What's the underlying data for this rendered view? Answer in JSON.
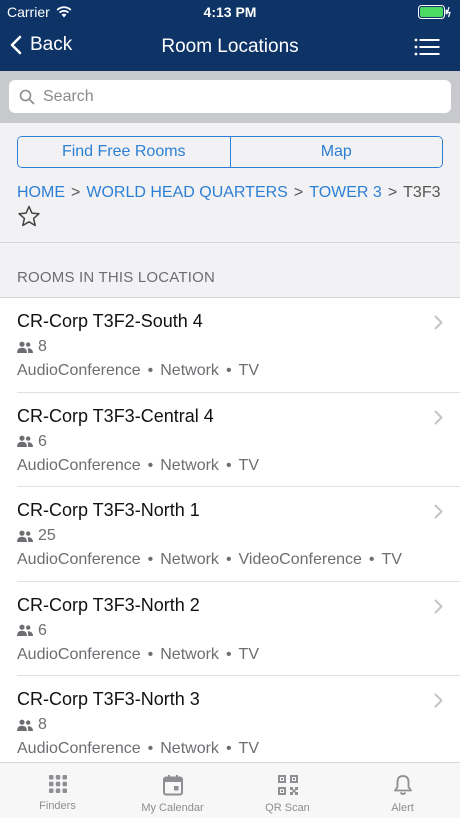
{
  "status": {
    "carrier": "Carrier",
    "time": "4:13 PM"
  },
  "nav": {
    "back_label": "Back",
    "title": "Room Locations"
  },
  "search": {
    "placeholder": "Search"
  },
  "segments": [
    "Find Free Rooms",
    "Map"
  ],
  "breadcrumb": {
    "items": [
      "HOME",
      "WORLD HEAD QUARTERS",
      "TOWER 3"
    ],
    "current": "T3F3",
    "separator": ">"
  },
  "section_title": "ROOMS IN THIS LOCATION",
  "rooms": [
    {
      "name": "CR-Corp T3F2-South 4",
      "capacity": "8",
      "features": [
        "AudioConference",
        "Network",
        "TV"
      ]
    },
    {
      "name": "CR-Corp T3F3-Central 4",
      "capacity": "6",
      "features": [
        "AudioConference",
        "Network",
        "TV"
      ]
    },
    {
      "name": "CR-Corp T3F3-North 1",
      "capacity": "25",
      "features": [
        "AudioConference",
        "Network",
        "VideoConference",
        "TV"
      ]
    },
    {
      "name": "CR-Corp T3F3-North 2",
      "capacity": "6",
      "features": [
        "AudioConference",
        "Network",
        "TV"
      ]
    },
    {
      "name": "CR-Corp T3F3-North 3",
      "capacity": "8",
      "features": [
        "AudioConference",
        "Network",
        "TV"
      ]
    }
  ],
  "tabs": [
    {
      "label": "Finders",
      "icon": "grid-icon"
    },
    {
      "label": "My Calendar",
      "icon": "calendar-icon"
    },
    {
      "label": "QR Scan",
      "icon": "qr-code-icon"
    },
    {
      "label": "Alert",
      "icon": "bell-icon"
    }
  ],
  "colors": {
    "nav_bg": "#0e3366",
    "accent": "#2d7fd4",
    "battery": "#4cd964"
  }
}
